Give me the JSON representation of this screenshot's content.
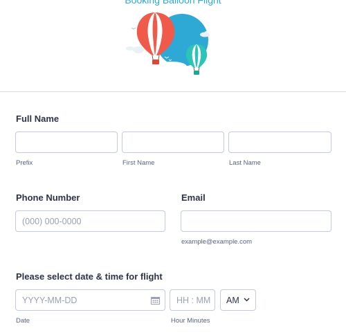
{
  "form": {
    "title": "Booking Balloon Flight"
  },
  "full_name": {
    "label": "Full Name",
    "prefix_sublabel": "Prefix",
    "first_sublabel": "First Name",
    "last_sublabel": "Last Name"
  },
  "phone": {
    "label": "Phone Number",
    "placeholder": "(000) 000-0000"
  },
  "email": {
    "label": "Email",
    "sublabel": "example@example.com"
  },
  "datetime": {
    "label": "Please select date & time for flight",
    "date_placeholder": "YYYY-MM-DD",
    "date_sublabel": "Date",
    "time_placeholder": "HH : MM",
    "time_sublabel": "Hour Minutes",
    "ampm_value": "AM"
  },
  "icons": {
    "hero": "hot-air-balloons-illustration",
    "calendar": "calendar-icon",
    "dropdown": "chevron-down-icon"
  },
  "colors": {
    "title": "#2ea9d6",
    "sky_circle": "#2ea9d6",
    "balloon_red": "#f05a4a",
    "balloon_teal": "#2bc4b6"
  }
}
